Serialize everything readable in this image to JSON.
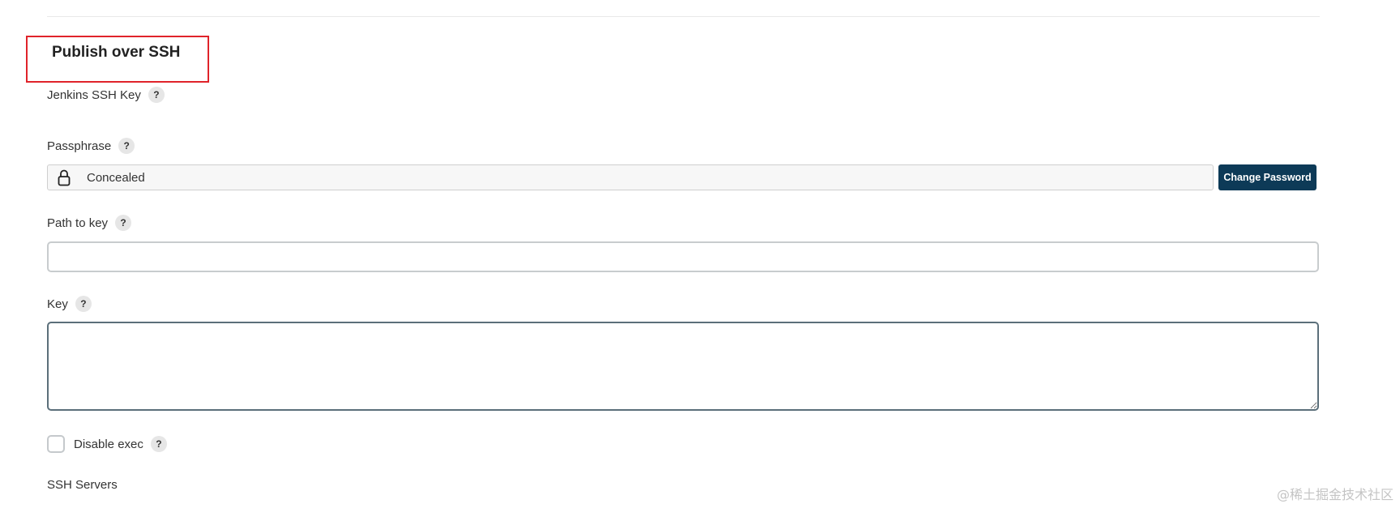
{
  "section": {
    "title": "Publish over SSH"
  },
  "fields": {
    "jenkins_ssh_key": {
      "label": "Jenkins SSH Key",
      "help": "?"
    },
    "passphrase": {
      "label": "Passphrase",
      "help": "?",
      "value": "Concealed",
      "change_button": "Change Password"
    },
    "path_to_key": {
      "label": "Path to key",
      "help": "?",
      "value": ""
    },
    "key": {
      "label": "Key",
      "help": "?",
      "value": ""
    },
    "disable_exec": {
      "label": "Disable exec",
      "help": "?",
      "checked": false
    },
    "ssh_servers": {
      "label": "SSH Servers"
    }
  },
  "watermark": "@稀土掘金技术社区",
  "colors": {
    "highlight": "#e0232a",
    "button": "#0d3a57"
  },
  "icons": {
    "lock": "lock-icon",
    "help": "help-icon"
  }
}
